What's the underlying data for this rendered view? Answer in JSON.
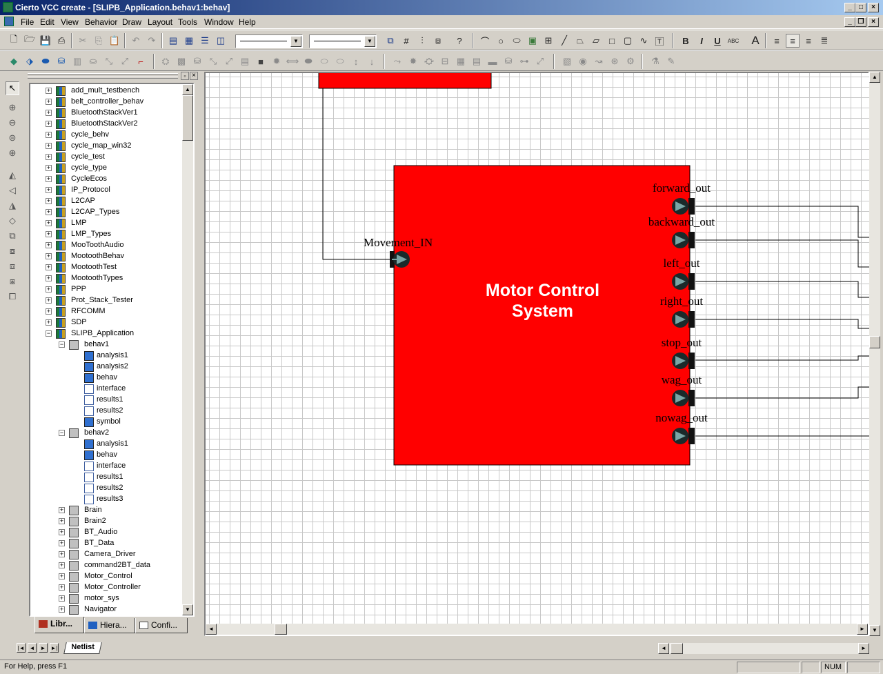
{
  "window": {
    "title": "Cierto VCC create - [SLIPB_Application.behav1:behav]",
    "controls": {
      "minimize": "_",
      "maximize": "□",
      "close": "×"
    },
    "mdi_controls": {
      "minimize": "_",
      "restore": "❐",
      "close": "×"
    }
  },
  "menu": [
    "File",
    "Edit",
    "View",
    "Behavior",
    "Draw",
    "Layout",
    "Tools",
    "Window",
    "Help"
  ],
  "library": {
    "tree": [
      {
        "label": "add_mult_testbench",
        "level": 0,
        "type": "lib",
        "expander": "+"
      },
      {
        "label": "belt_controller_behav",
        "level": 0,
        "type": "lib",
        "expander": "+"
      },
      {
        "label": "BluetoothStackVer1",
        "level": 0,
        "type": "lib",
        "expander": "+"
      },
      {
        "label": "BluetoothStackVer2",
        "level": 0,
        "type": "lib",
        "expander": "+"
      },
      {
        "label": "cycle_behv",
        "level": 0,
        "type": "lib",
        "expander": "+"
      },
      {
        "label": "cycle_map_win32",
        "level": 0,
        "type": "lib",
        "expander": "+"
      },
      {
        "label": "cycle_test",
        "level": 0,
        "type": "lib",
        "expander": "+"
      },
      {
        "label": "cycle_type",
        "level": 0,
        "type": "lib",
        "expander": "+"
      },
      {
        "label": "CycleEcos",
        "level": 0,
        "type": "lib",
        "expander": "+"
      },
      {
        "label": "IP_Protocol",
        "level": 0,
        "type": "lib",
        "expander": "+"
      },
      {
        "label": "L2CAP",
        "level": 0,
        "type": "lib",
        "expander": "+"
      },
      {
        "label": "L2CAP_Types",
        "level": 0,
        "type": "lib",
        "expander": "+"
      },
      {
        "label": "LMP",
        "level": 0,
        "type": "lib",
        "expander": "+"
      },
      {
        "label": "LMP_Types",
        "level": 0,
        "type": "lib",
        "expander": "+"
      },
      {
        "label": "MooToothAudio",
        "level": 0,
        "type": "lib",
        "expander": "+"
      },
      {
        "label": "MootoothBehav",
        "level": 0,
        "type": "lib",
        "expander": "+"
      },
      {
        "label": "MootoothTest",
        "level": 0,
        "type": "lib",
        "expander": "+"
      },
      {
        "label": "MootoothTypes",
        "level": 0,
        "type": "lib",
        "expander": "+"
      },
      {
        "label": "PPP",
        "level": 0,
        "type": "lib",
        "expander": "+"
      },
      {
        "label": "Prot_Stack_Tester",
        "level": 0,
        "type": "lib",
        "expander": "+"
      },
      {
        "label": "RFCOMM",
        "level": 0,
        "type": "lib",
        "expander": "+"
      },
      {
        "label": "SDP",
        "level": 0,
        "type": "lib",
        "expander": "+"
      },
      {
        "label": "SLIPB_Application",
        "level": 0,
        "type": "lib",
        "expander": "−"
      },
      {
        "label": "behav1",
        "level": 1,
        "type": "cell",
        "expander": "−"
      },
      {
        "label": "analysis1",
        "level": 2,
        "type": "view",
        "expander": ""
      },
      {
        "label": "analysis2",
        "level": 2,
        "type": "view",
        "expander": ""
      },
      {
        "label": "behav",
        "level": 2,
        "type": "view",
        "expander": ""
      },
      {
        "label": "interface",
        "level": 2,
        "type": "res",
        "expander": ""
      },
      {
        "label": "results1",
        "level": 2,
        "type": "res",
        "expander": ""
      },
      {
        "label": "results2",
        "level": 2,
        "type": "res",
        "expander": ""
      },
      {
        "label": "symbol",
        "level": 2,
        "type": "view",
        "expander": ""
      },
      {
        "label": "behav2",
        "level": 1,
        "type": "cell",
        "expander": "−"
      },
      {
        "label": "analysis1",
        "level": 2,
        "type": "view",
        "expander": ""
      },
      {
        "label": "behav",
        "level": 2,
        "type": "view",
        "expander": ""
      },
      {
        "label": "interface",
        "level": 2,
        "type": "res",
        "expander": ""
      },
      {
        "label": "results1",
        "level": 2,
        "type": "res",
        "expander": ""
      },
      {
        "label": "results2",
        "level": 2,
        "type": "res",
        "expander": ""
      },
      {
        "label": "results3",
        "level": 2,
        "type": "res",
        "expander": ""
      },
      {
        "label": "Brain",
        "level": 1,
        "type": "cell",
        "expander": "+"
      },
      {
        "label": "Brain2",
        "level": 1,
        "type": "cell",
        "expander": "+"
      },
      {
        "label": "BT_Audio",
        "level": 1,
        "type": "cell",
        "expander": "+"
      },
      {
        "label": "BT_Data",
        "level": 1,
        "type": "cell",
        "expander": "+"
      },
      {
        "label": "Camera_Driver",
        "level": 1,
        "type": "cell",
        "expander": "+"
      },
      {
        "label": "command2BT_data",
        "level": 1,
        "type": "cell",
        "expander": "+"
      },
      {
        "label": "Motor_Control",
        "level": 1,
        "type": "cell",
        "expander": "+"
      },
      {
        "label": "Motor_Controller",
        "level": 1,
        "type": "cell",
        "expander": "+"
      },
      {
        "label": "motor_sys",
        "level": 1,
        "type": "cell",
        "expander": "+"
      },
      {
        "label": "Navigator",
        "level": 1,
        "type": "cell",
        "expander": "+"
      }
    ],
    "tabs": [
      "Libr...",
      "Hiera...",
      "Confi..."
    ]
  },
  "diagram": {
    "block_title_line1": "Motor Control",
    "block_title_line2": "System",
    "block_color": "#ff0000",
    "input_port": "Movement_IN",
    "output_ports": [
      "forward_out",
      "backward_out",
      "left_out",
      "right_out",
      "stop_out",
      "wag_out",
      "nowag_out"
    ]
  },
  "sheet_tab": "Netlist",
  "status": {
    "help": "For Help, press F1",
    "num": "NUM"
  }
}
